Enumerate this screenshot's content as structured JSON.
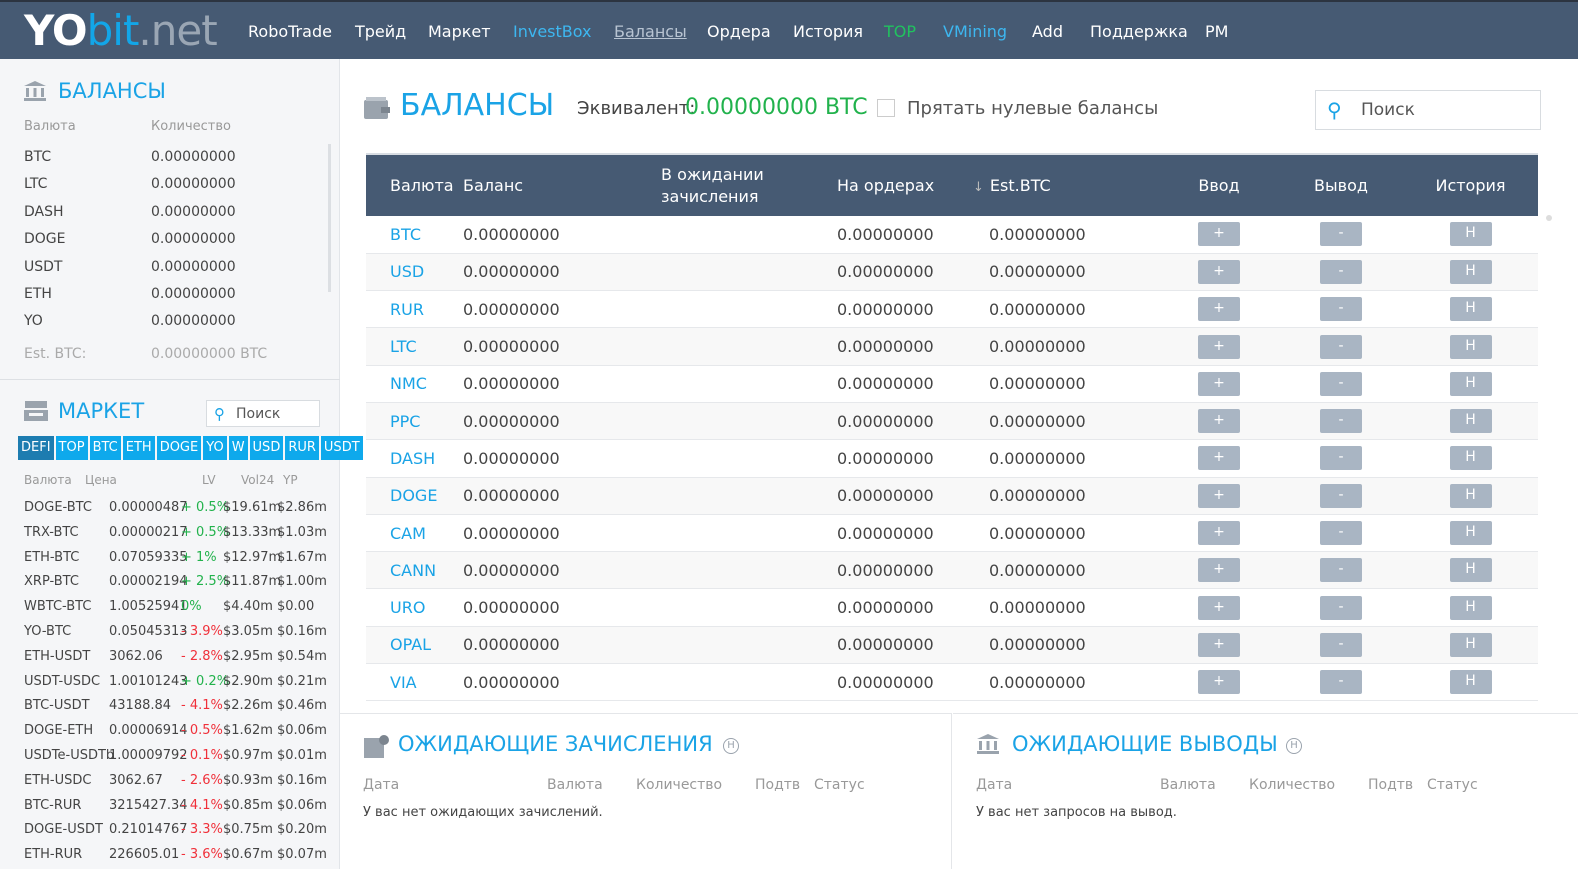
{
  "logo": {
    "yo": "YO",
    "bit": "bit",
    "net": ".net"
  },
  "nav": [
    {
      "label": "RoboTrade",
      "style": ""
    },
    {
      "label": "Трейд",
      "style": ""
    },
    {
      "label": "Маркет",
      "style": ""
    },
    {
      "label": "InvestBox",
      "style": "blue"
    },
    {
      "label": "Балансы",
      "style": "ul"
    },
    {
      "label": "Ордера",
      "style": ""
    },
    {
      "label": "История",
      "style": ""
    },
    {
      "label": "TOP",
      "style": "green"
    },
    {
      "label": "VMining",
      "style": "blue"
    },
    {
      "label": "Add",
      "style": ""
    },
    {
      "label": "Поддержка",
      "style": ""
    },
    {
      "label": "PM",
      "style": ""
    }
  ],
  "sidebar": {
    "balances_title": "БАЛАНСЫ",
    "col_currency": "Валюта",
    "col_amount": "Количество",
    "balances": [
      [
        "BTC",
        "0.00000000"
      ],
      [
        "LTC",
        "0.00000000"
      ],
      [
        "DASH",
        "0.00000000"
      ],
      [
        "DOGE",
        "0.00000000"
      ],
      [
        "USDT",
        "0.00000000"
      ],
      [
        "ETH",
        "0.00000000"
      ],
      [
        "YO",
        "0.00000000"
      ]
    ],
    "est_label": "Est. BTC:",
    "est_value": "0.00000000 BTC",
    "market_title": "МАРКЕТ",
    "market_search_placeholder": "Поиск",
    "tabs": [
      "DEFI",
      "TOP",
      "BTC",
      "ETH",
      "DOGE",
      "YO",
      "W",
      "USD",
      "RUR",
      "USDT"
    ],
    "market_headers": [
      "Валюта",
      "Цена",
      "LV",
      "Vol24",
      "YP"
    ],
    "market": [
      [
        "DOGE-BTC",
        "0.00000487",
        "+ 0.5%",
        "$19.61m",
        "$2.86m"
      ],
      [
        "TRX-BTC",
        "0.00000217",
        "+ 0.5%",
        "$13.33m",
        "$1.03m"
      ],
      [
        "ETH-BTC",
        "0.07059335",
        "+ 1%",
        "$12.97m",
        "$1.67m"
      ],
      [
        "XRP-BTC",
        "0.00002194",
        "+ 2.5%",
        "$11.87m",
        "$1.00m"
      ],
      [
        "WBTC-BTC",
        "1.00525941",
        "0%",
        "$4.40m",
        "$0.00"
      ],
      [
        "YO-BTC",
        "0.05045313",
        "- 3.9%",
        "$3.05m",
        "$0.16m"
      ],
      [
        "ETH-USDT",
        "3062.06",
        "- 2.8%",
        "$2.95m",
        "$0.54m"
      ],
      [
        "USDT-USDC",
        "1.00101243",
        "+ 0.2%",
        "$2.90m",
        "$0.21m"
      ],
      [
        "BTC-USDT",
        "43188.84",
        "- 4.1%",
        "$2.26m",
        "$0.46m"
      ],
      [
        "DOGE-ETH",
        "0.00006914",
        "- 0.5%",
        "$1.62m",
        "$0.06m"
      ],
      [
        "USDTe-USDTb",
        "1.00009792",
        "- 0.1%",
        "$0.97m",
        "$0.01m"
      ],
      [
        "ETH-USDC",
        "3062.67",
        "- 2.6%",
        "$0.93m",
        "$0.16m"
      ],
      [
        "BTC-RUR",
        "3215427.34",
        "- 4.1%",
        "$0.85m",
        "$0.06m"
      ],
      [
        "DOGE-USDT",
        "0.21014767",
        "- 3.3%",
        "$0.75m",
        "$0.20m"
      ],
      [
        "ETH-RUR",
        "226605.01",
        "- 3.6%",
        "$0.67m",
        "$0.07m"
      ]
    ]
  },
  "main": {
    "title": "БАЛАНСЫ",
    "equiv_label": "Эквивалент:",
    "equiv_value": "0.00000000 BTC",
    "hide_zero_label": "Прятать нулевые балансы",
    "search_placeholder": "Поиск",
    "headers": [
      "Валюта",
      "Баланс",
      "В ожидании зачисления",
      "На ордерах",
      "Est.BTC",
      "Ввод",
      "Вывод",
      "История"
    ],
    "btn_deposit": "+",
    "btn_withdraw": "-",
    "btn_history": "H",
    "rows": [
      [
        "BTC",
        "0.00000000",
        "",
        "0.00000000",
        "0.00000000"
      ],
      [
        "USD",
        "0.00000000",
        "",
        "0.00000000",
        "0.00000000"
      ],
      [
        "RUR",
        "0.00000000",
        "",
        "0.00000000",
        "0.00000000"
      ],
      [
        "LTC",
        "0.00000000",
        "",
        "0.00000000",
        "0.00000000"
      ],
      [
        "NMC",
        "0.00000000",
        "",
        "0.00000000",
        "0.00000000"
      ],
      [
        "PPC",
        "0.00000000",
        "",
        "0.00000000",
        "0.00000000"
      ],
      [
        "DASH",
        "0.00000000",
        "",
        "0.00000000",
        "0.00000000"
      ],
      [
        "DOGE",
        "0.00000000",
        "",
        "0.00000000",
        "0.00000000"
      ],
      [
        "CAM",
        "0.00000000",
        "",
        "0.00000000",
        "0.00000000"
      ],
      [
        "CANN",
        "0.00000000",
        "",
        "0.00000000",
        "0.00000000"
      ],
      [
        "URO",
        "0.00000000",
        "",
        "0.00000000",
        "0.00000000"
      ],
      [
        "OPAL",
        "0.00000000",
        "",
        "0.00000000",
        "0.00000000"
      ],
      [
        "VIA",
        "0.00000000",
        "",
        "0.00000000",
        "0.00000000"
      ]
    ]
  },
  "pending_deposits": {
    "title": "ОЖИДАЮЩИЕ ЗАЧИСЛЕНИЯ",
    "headers": [
      "Дата",
      "Валюта",
      "Количество",
      "Подтв",
      "Статус"
    ],
    "empty": "У вас нет ожидающих зачислений."
  },
  "pending_withdrawals": {
    "title": "ОЖИДАЮЩИЕ ВЫВОДЫ",
    "headers": [
      "Дата",
      "Валюта",
      "Количество",
      "Подтв",
      "Статус"
    ],
    "empty": "У вас нет запросов на вывод."
  }
}
